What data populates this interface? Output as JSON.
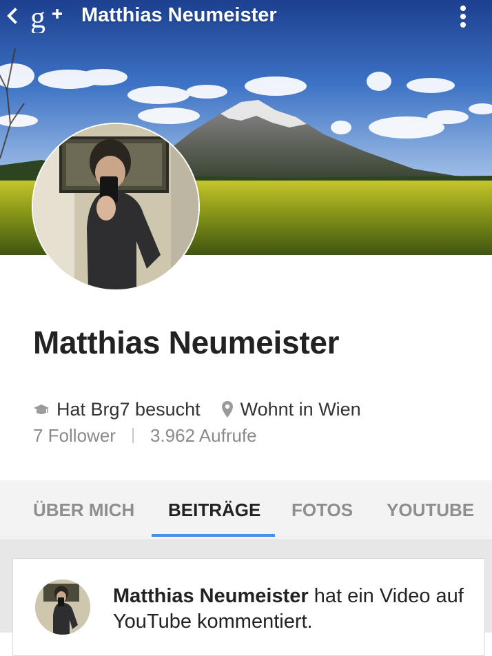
{
  "app_bar": {
    "title": "Matthias Neumeister",
    "back_icon": "chevron-left-icon",
    "logo_icon": "google-plus-icon",
    "menu_icon": "overflow-menu-icon"
  },
  "profile": {
    "name": "Matthias Neumeister",
    "education": "Hat Brg7 besucht",
    "education_icon": "graduation-cap-icon",
    "location": "Wohnt in Wien",
    "location_icon": "map-pin-icon",
    "followers": "7 Follower",
    "views": "3.962 Aufrufe"
  },
  "tabs": [
    {
      "label": "ÜBER MICH",
      "active": false
    },
    {
      "label": "BEITRÄGE",
      "active": true
    },
    {
      "label": "FOTOS",
      "active": false
    },
    {
      "label": "YOUTUBE",
      "active": false
    }
  ],
  "post": {
    "author": "Matthias Neumeister",
    "text": " hat ein Video auf YouTube kommentiert."
  },
  "colors": {
    "accent": "#4a90e2",
    "tab_inactive": "#8e8e8e",
    "tab_bar_bg": "#f3f3f3"
  }
}
